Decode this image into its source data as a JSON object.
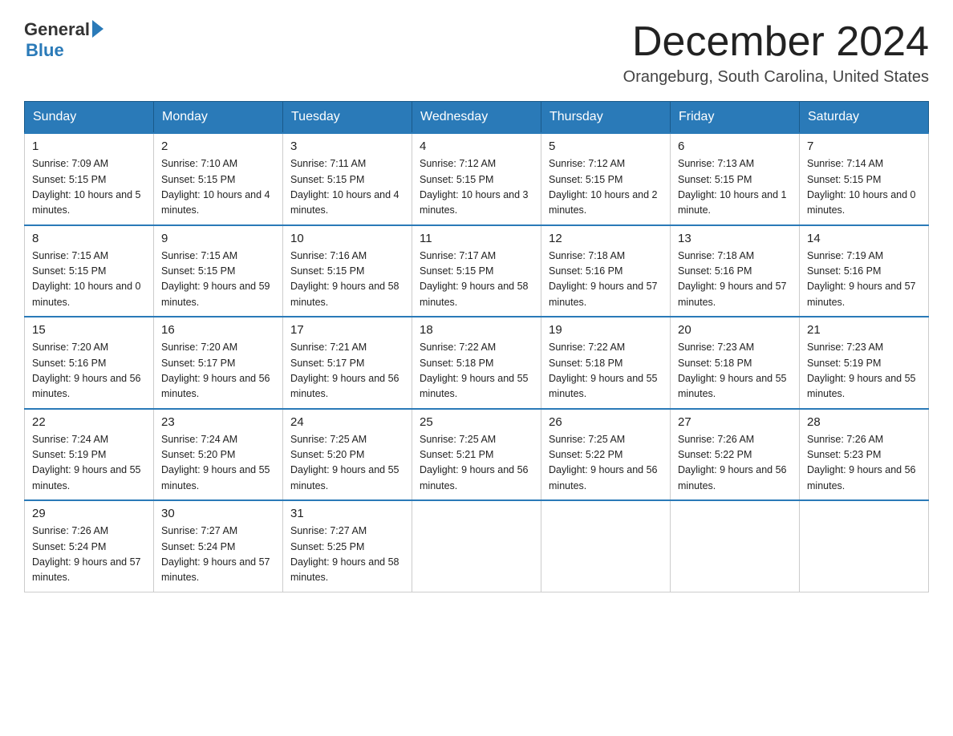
{
  "logo": {
    "general": "General",
    "blue": "Blue",
    "arrow": "▶"
  },
  "title": "December 2024",
  "subtitle": "Orangeburg, South Carolina, United States",
  "days_of_week": [
    "Sunday",
    "Monday",
    "Tuesday",
    "Wednesday",
    "Thursday",
    "Friday",
    "Saturday"
  ],
  "weeks": [
    [
      {
        "day": "1",
        "sunrise": "7:09 AM",
        "sunset": "5:15 PM",
        "daylight": "10 hours and 5 minutes."
      },
      {
        "day": "2",
        "sunrise": "7:10 AM",
        "sunset": "5:15 PM",
        "daylight": "10 hours and 4 minutes."
      },
      {
        "day": "3",
        "sunrise": "7:11 AM",
        "sunset": "5:15 PM",
        "daylight": "10 hours and 4 minutes."
      },
      {
        "day": "4",
        "sunrise": "7:12 AM",
        "sunset": "5:15 PM",
        "daylight": "10 hours and 3 minutes."
      },
      {
        "day": "5",
        "sunrise": "7:12 AM",
        "sunset": "5:15 PM",
        "daylight": "10 hours and 2 minutes."
      },
      {
        "day": "6",
        "sunrise": "7:13 AM",
        "sunset": "5:15 PM",
        "daylight": "10 hours and 1 minute."
      },
      {
        "day": "7",
        "sunrise": "7:14 AM",
        "sunset": "5:15 PM",
        "daylight": "10 hours and 0 minutes."
      }
    ],
    [
      {
        "day": "8",
        "sunrise": "7:15 AM",
        "sunset": "5:15 PM",
        "daylight": "10 hours and 0 minutes."
      },
      {
        "day": "9",
        "sunrise": "7:15 AM",
        "sunset": "5:15 PM",
        "daylight": "9 hours and 59 minutes."
      },
      {
        "day": "10",
        "sunrise": "7:16 AM",
        "sunset": "5:15 PM",
        "daylight": "9 hours and 58 minutes."
      },
      {
        "day": "11",
        "sunrise": "7:17 AM",
        "sunset": "5:15 PM",
        "daylight": "9 hours and 58 minutes."
      },
      {
        "day": "12",
        "sunrise": "7:18 AM",
        "sunset": "5:16 PM",
        "daylight": "9 hours and 57 minutes."
      },
      {
        "day": "13",
        "sunrise": "7:18 AM",
        "sunset": "5:16 PM",
        "daylight": "9 hours and 57 minutes."
      },
      {
        "day": "14",
        "sunrise": "7:19 AM",
        "sunset": "5:16 PM",
        "daylight": "9 hours and 57 minutes."
      }
    ],
    [
      {
        "day": "15",
        "sunrise": "7:20 AM",
        "sunset": "5:16 PM",
        "daylight": "9 hours and 56 minutes."
      },
      {
        "day": "16",
        "sunrise": "7:20 AM",
        "sunset": "5:17 PM",
        "daylight": "9 hours and 56 minutes."
      },
      {
        "day": "17",
        "sunrise": "7:21 AM",
        "sunset": "5:17 PM",
        "daylight": "9 hours and 56 minutes."
      },
      {
        "day": "18",
        "sunrise": "7:22 AM",
        "sunset": "5:18 PM",
        "daylight": "9 hours and 55 minutes."
      },
      {
        "day": "19",
        "sunrise": "7:22 AM",
        "sunset": "5:18 PM",
        "daylight": "9 hours and 55 minutes."
      },
      {
        "day": "20",
        "sunrise": "7:23 AM",
        "sunset": "5:18 PM",
        "daylight": "9 hours and 55 minutes."
      },
      {
        "day": "21",
        "sunrise": "7:23 AM",
        "sunset": "5:19 PM",
        "daylight": "9 hours and 55 minutes."
      }
    ],
    [
      {
        "day": "22",
        "sunrise": "7:24 AM",
        "sunset": "5:19 PM",
        "daylight": "9 hours and 55 minutes."
      },
      {
        "day": "23",
        "sunrise": "7:24 AM",
        "sunset": "5:20 PM",
        "daylight": "9 hours and 55 minutes."
      },
      {
        "day": "24",
        "sunrise": "7:25 AM",
        "sunset": "5:20 PM",
        "daylight": "9 hours and 55 minutes."
      },
      {
        "day": "25",
        "sunrise": "7:25 AM",
        "sunset": "5:21 PM",
        "daylight": "9 hours and 56 minutes."
      },
      {
        "day": "26",
        "sunrise": "7:25 AM",
        "sunset": "5:22 PM",
        "daylight": "9 hours and 56 minutes."
      },
      {
        "day": "27",
        "sunrise": "7:26 AM",
        "sunset": "5:22 PM",
        "daylight": "9 hours and 56 minutes."
      },
      {
        "day": "28",
        "sunrise": "7:26 AM",
        "sunset": "5:23 PM",
        "daylight": "9 hours and 56 minutes."
      }
    ],
    [
      {
        "day": "29",
        "sunrise": "7:26 AM",
        "sunset": "5:24 PM",
        "daylight": "9 hours and 57 minutes."
      },
      {
        "day": "30",
        "sunrise": "7:27 AM",
        "sunset": "5:24 PM",
        "daylight": "9 hours and 57 minutes."
      },
      {
        "day": "31",
        "sunrise": "7:27 AM",
        "sunset": "5:25 PM",
        "daylight": "9 hours and 58 minutes."
      },
      null,
      null,
      null,
      null
    ]
  ]
}
